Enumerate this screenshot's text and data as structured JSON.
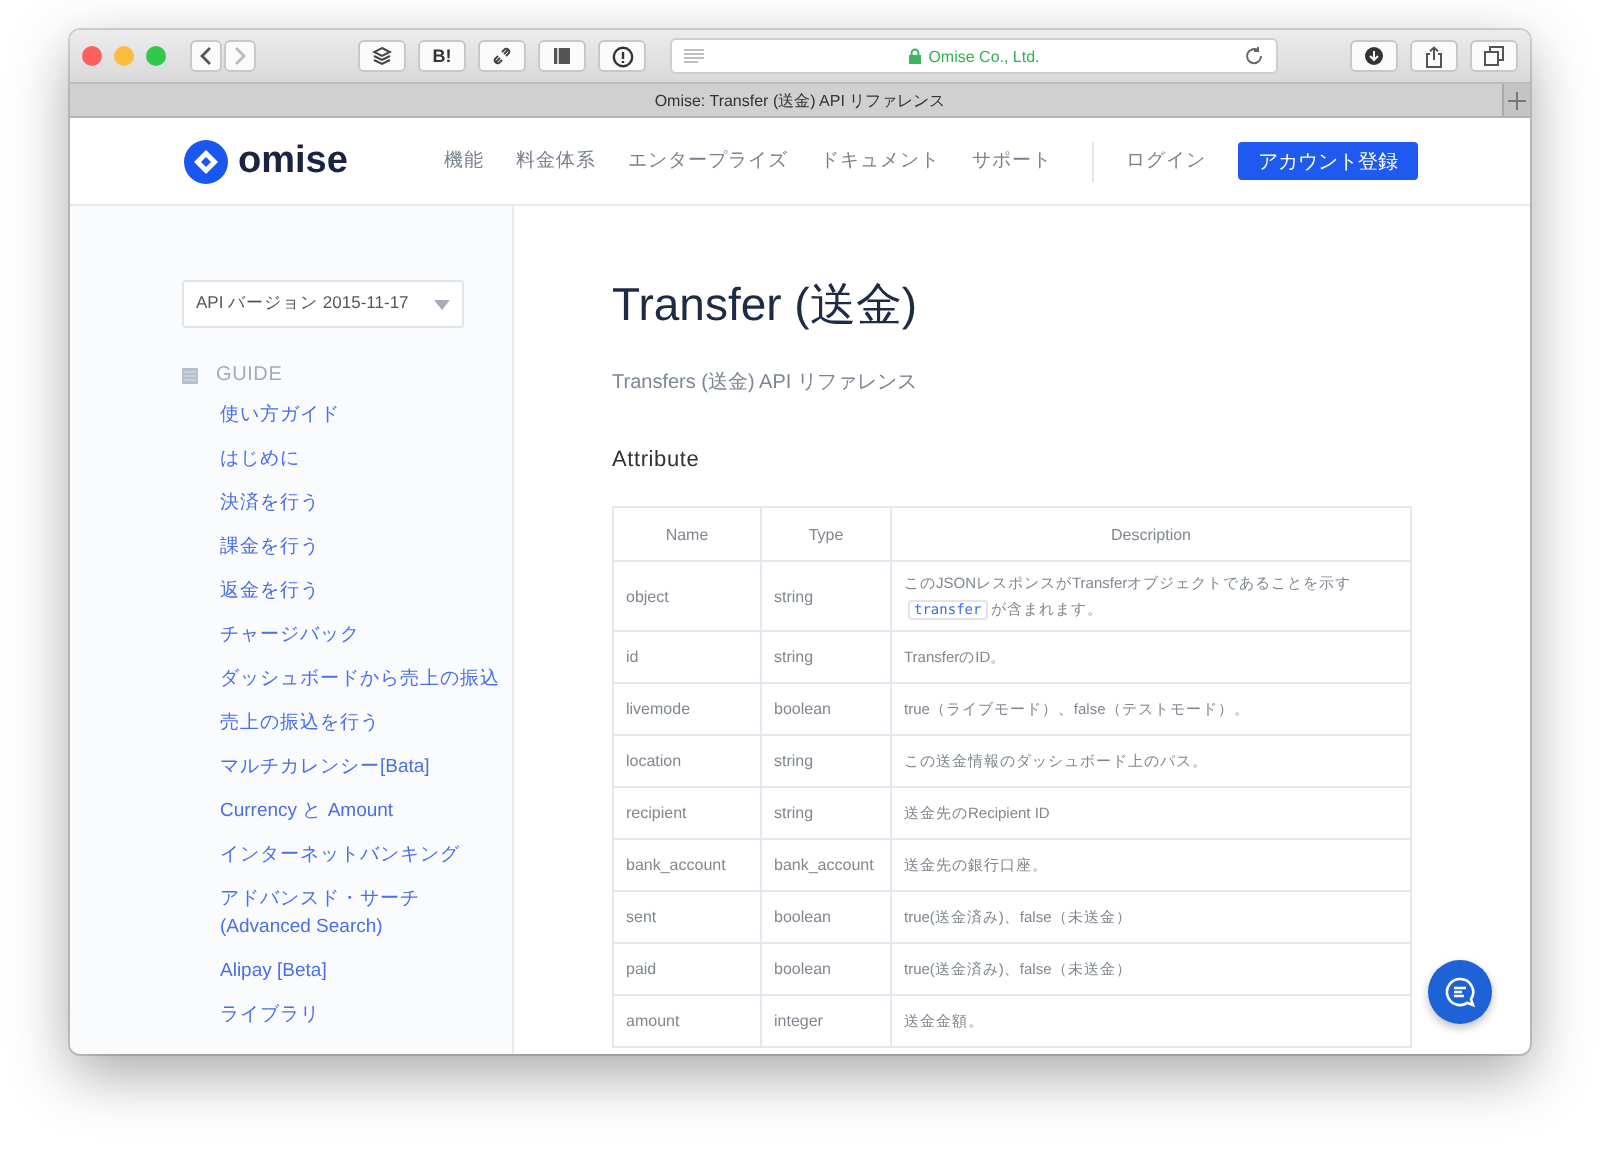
{
  "browser": {
    "address": "Omise Co., Ltd.",
    "tab_title": "Omise: Transfer (送金) API リファレンス",
    "toolbar_text": "B!"
  },
  "header": {
    "logo": "omise",
    "nav": [
      "機能",
      "料金体系",
      "エンタープライズ",
      "ドキュメント",
      "サポート"
    ],
    "login": "ログイン",
    "signup": "アカウント登録"
  },
  "sidebar": {
    "version": "API バージョン 2015-11-17",
    "section": "GUIDE",
    "items": [
      {
        "label": "使い方ガイド"
      },
      {
        "label": "はじめに"
      },
      {
        "label": "決済を行う"
      },
      {
        "label": "課金を行う"
      },
      {
        "label": "返金を行う"
      },
      {
        "label": "チャージバック"
      },
      {
        "label": "ダッシュボードから売上の振込"
      },
      {
        "label": "売上の振込を行う"
      },
      {
        "label": "マルチカレンシー[Bata]"
      },
      {
        "label": "Currency と Amount"
      },
      {
        "label": "インターネットバンキング"
      },
      {
        "label": "アドバンスド・サーチ (Advanced Search)"
      },
      {
        "label": "Alipay [Beta]"
      },
      {
        "label": "ライブラリ"
      }
    ]
  },
  "main": {
    "title": "Transfer (送金)",
    "subtitle": "Transfers (送金) API リファレンス",
    "section": "Attribute",
    "table": {
      "columns": [
        "Name",
        "Type",
        "Description"
      ],
      "rows": [
        {
          "name": "object",
          "type": "string",
          "description": "このJSONレスポンスがTransferオブジェクトであることを示す",
          "code": "transfer",
          "description_after": "が含まれます。"
        },
        {
          "name": "id",
          "type": "string",
          "description": "TransferのID。"
        },
        {
          "name": "livemode",
          "type": "boolean",
          "description": "true（ライブモード）、false（テストモード）。"
        },
        {
          "name": "location",
          "type": "string",
          "description": "この送金情報のダッシュボード上のパス。"
        },
        {
          "name": "recipient",
          "type": "string",
          "description": "送金先のRecipient ID"
        },
        {
          "name": "bank_account",
          "type": "bank_account",
          "description": "送金先の銀行口座。"
        },
        {
          "name": "sent",
          "type": "boolean",
          "description": "true(送金済み)、false（未送金）"
        },
        {
          "name": "paid",
          "type": "boolean",
          "description": "true(送金済み)、false（未送金）"
        },
        {
          "name": "amount",
          "type": "integer",
          "description": "送金金額。"
        }
      ]
    }
  }
}
